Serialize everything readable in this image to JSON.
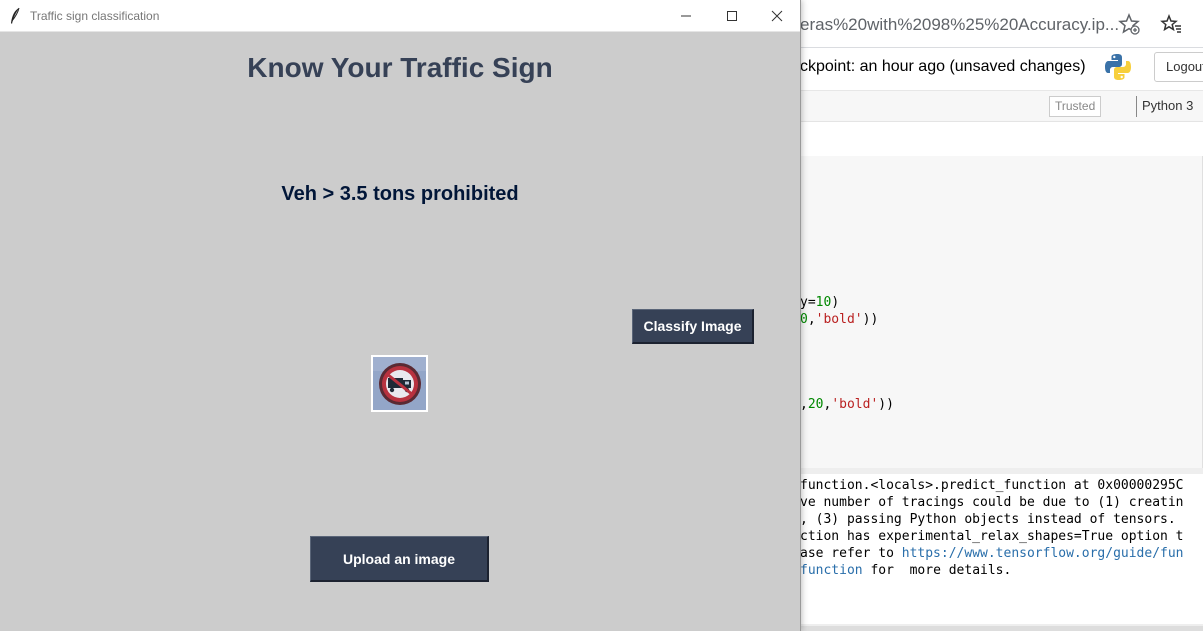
{
  "browser": {
    "url": "eras%20with%2098%25%20Accuracy.ip...",
    "icons": {
      "add_star": "star-plus-icon",
      "favorites": "favorites-icon"
    }
  },
  "jupyter": {
    "checkpoint": "ckpoint: an hour ago  (unsaved changes)",
    "logout_label": "Logout",
    "trusted_label": "Trusted",
    "kernel_label": "Python 3",
    "code": {
      "line1_pre": "y=",
      "line1_num": "10",
      "line1_post": ")",
      "line2_num": "0",
      "line2_pre": ",",
      "line2_str": "'bold'",
      "line2_post": "))",
      "line3_pre": ",",
      "line3_num": "20",
      "line3_mid": ",",
      "line3_str": "'bold'",
      "line3_post": "))"
    },
    "output": {
      "l1": "function.<locals>.predict_function at 0x00000295C",
      "l2": "ve number of tracings could be due to (1) creatin",
      "l3": ", (3) passing Python objects instead of tensors.",
      "l4": "ction has experimental_relax_shapes=True option t",
      "l5_pre": "ase refer to ",
      "l5_link": "https://www.tensorflow.org/guide/fun",
      "l6_link": "function",
      "l6_post": " for  more details."
    }
  },
  "app": {
    "window_title": "Traffic sign classification",
    "heading": "Know Your Traffic Sign",
    "result_label": "Veh > 3.5 tons prohibited",
    "classify_button": "Classify Image",
    "upload_button": "Upload an image",
    "colors": {
      "background": "#cccccc",
      "heading": "#364156",
      "result": "#011638",
      "button_bg": "#364156",
      "button_fg": "#ffffff"
    }
  }
}
